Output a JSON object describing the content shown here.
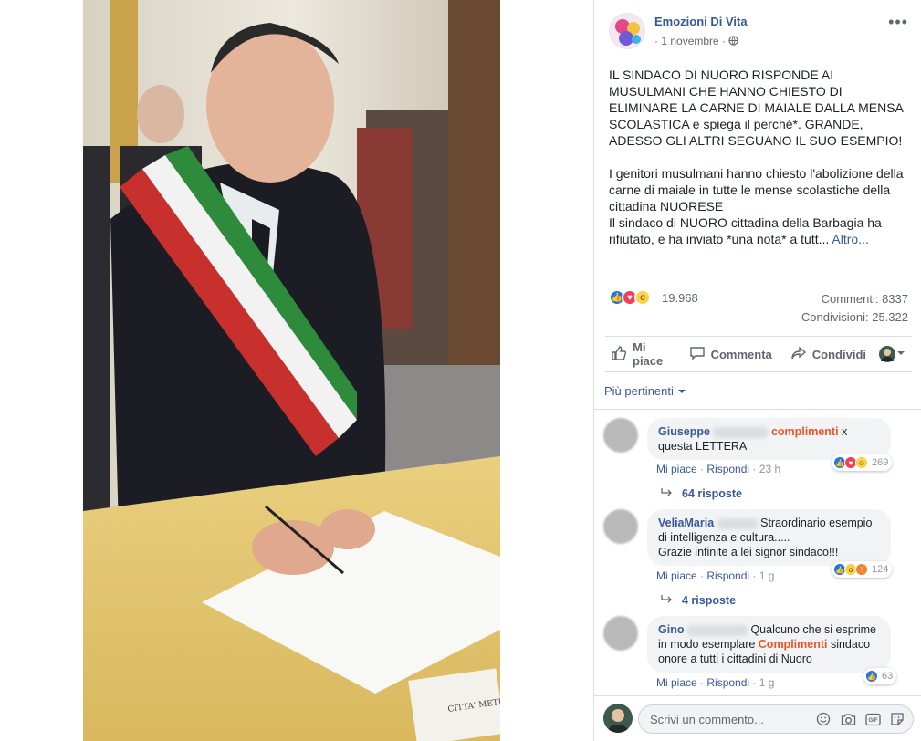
{
  "post": {
    "author": "Emozioni Di Vita",
    "date": "1 novembre",
    "paragraph1": "IL SINDACO DI NUORO RISPONDE AI MUSULMANI CHE HANNO CHIESTO DI ELIMINARE LA CARNE DI MAIALE DALLA MENSA SCOLASTICA e spiega il perché*. GRANDE, ADESSO GLI ALTRI SEGUANO IL SUO ESEMPIO!",
    "paragraph2a": "I genitori musulmani hanno chiesto l'abolizione della carne di maiale in tutte le mense scolastiche della cittadina NUORESE",
    "paragraph2b": "Il sindaco di NUORO cittadina della Barbagia ha rifiutato, e ha inviato *una nota* a tutt...",
    "more": "Altro...",
    "reactions_count": "19.968",
    "comments_count": "Commenti: 8337",
    "shares_count": "Condivisioni: 25.322",
    "photo_caption_sign": "CITTA' METR"
  },
  "actions": {
    "like": "Mi piace",
    "comment": "Commenta",
    "share": "Condividi"
  },
  "filter": "Più pertinenti",
  "comments": [
    {
      "name": "Giuseppe",
      "highlight": "complimenti",
      "text_after": " x questa LETTERA",
      "text_before": "",
      "like": "Mi piace",
      "reply": "Rispondi",
      "time": "23 h",
      "reaction_count": "269",
      "replies": "64 risposte"
    },
    {
      "name": "VeliaMaria",
      "text_before": "Straordinario esempio di intelligenza e cultura.....",
      "text_line2": "Grazie infinite a lei signor sindaco!!!",
      "like": "Mi piace",
      "reply": "Rispondi",
      "time": "1 g",
      "reaction_count": "124",
      "replies": "4 risposte"
    },
    {
      "name": "Gino",
      "text_before": "Qualcuno che si esprime in modo esemplare ",
      "highlight": "Complimenti",
      "text_after": " sindaco onore a tutti i cittadini di Nuoro",
      "like": "Mi piace",
      "reply": "Rispondi",
      "time": "1 g",
      "reaction_count": "63"
    }
  ],
  "composer": {
    "placeholder": "Scrivi un commento...",
    "gif": "GIF"
  },
  "colors": {
    "link": "#385898",
    "like_blue": "#1877f2",
    "love_red": "#f33e58",
    "wow_yellow": "#fcd147",
    "highlight": "#e9552b"
  },
  "icons": [
    "globe-icon",
    "more-icon",
    "like-icon",
    "comment-icon",
    "share-icon",
    "chevron-down-icon",
    "reply-arrow-icon",
    "emoji-icon",
    "camera-icon",
    "gif-icon",
    "sticker-icon"
  ]
}
